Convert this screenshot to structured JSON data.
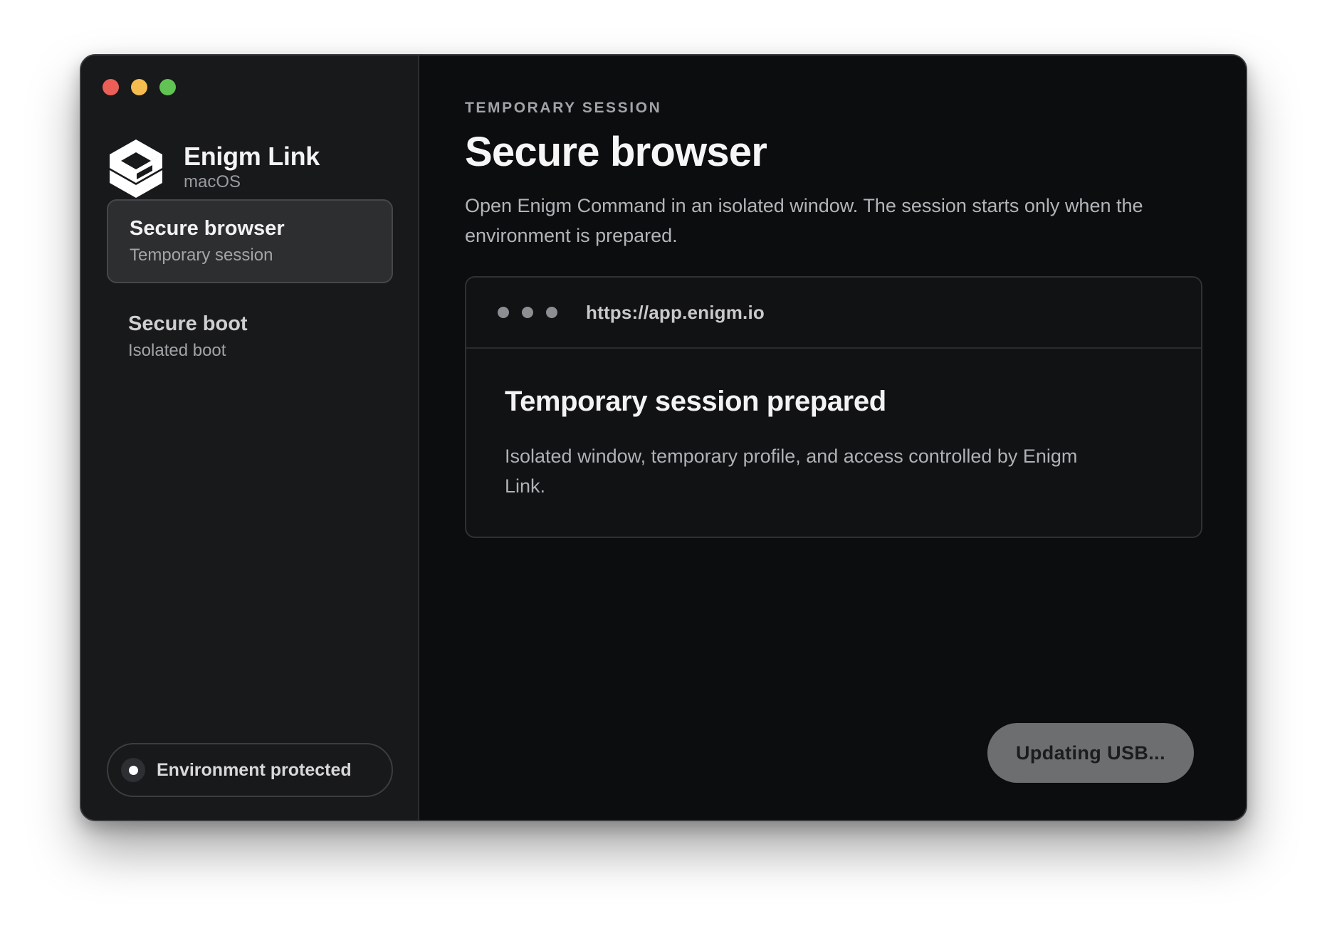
{
  "window": {
    "traffic_lights": [
      {
        "name": "close",
        "color": "#ec5f57"
      },
      {
        "name": "minimize",
        "color": "#f5bd4f"
      },
      {
        "name": "zoom",
        "color": "#61c354"
      }
    ]
  },
  "sidebar": {
    "app_name": "Enigm Link",
    "platform": "macOS",
    "logo_icon": "enigm-logo-icon",
    "items": [
      {
        "title": "Secure browser",
        "subtitle": "Temporary session",
        "active": true
      },
      {
        "title": "Secure boot",
        "subtitle": "Isolated boot",
        "active": false
      }
    ],
    "status": {
      "label": "Environment protected",
      "icon": "status-dot-icon"
    }
  },
  "main": {
    "eyebrow": "TEMPORARY SESSION",
    "title": "Secure browser",
    "description": "Open Enigm Command in an isolated window. The session starts only when the environment is prepared.",
    "browser_preview": {
      "url": "https://app.enigm.io",
      "heading": "Temporary session prepared",
      "body": "Isolated window, temporary profile, and access controlled by Enigm Link."
    },
    "action_button": "Updating USB..."
  },
  "colors": {
    "window_bg": "#0c0d0f",
    "sidebar_bg": "#18191b",
    "active_item_bg": "#2d2e30",
    "button_bg": "#6d6e70"
  }
}
